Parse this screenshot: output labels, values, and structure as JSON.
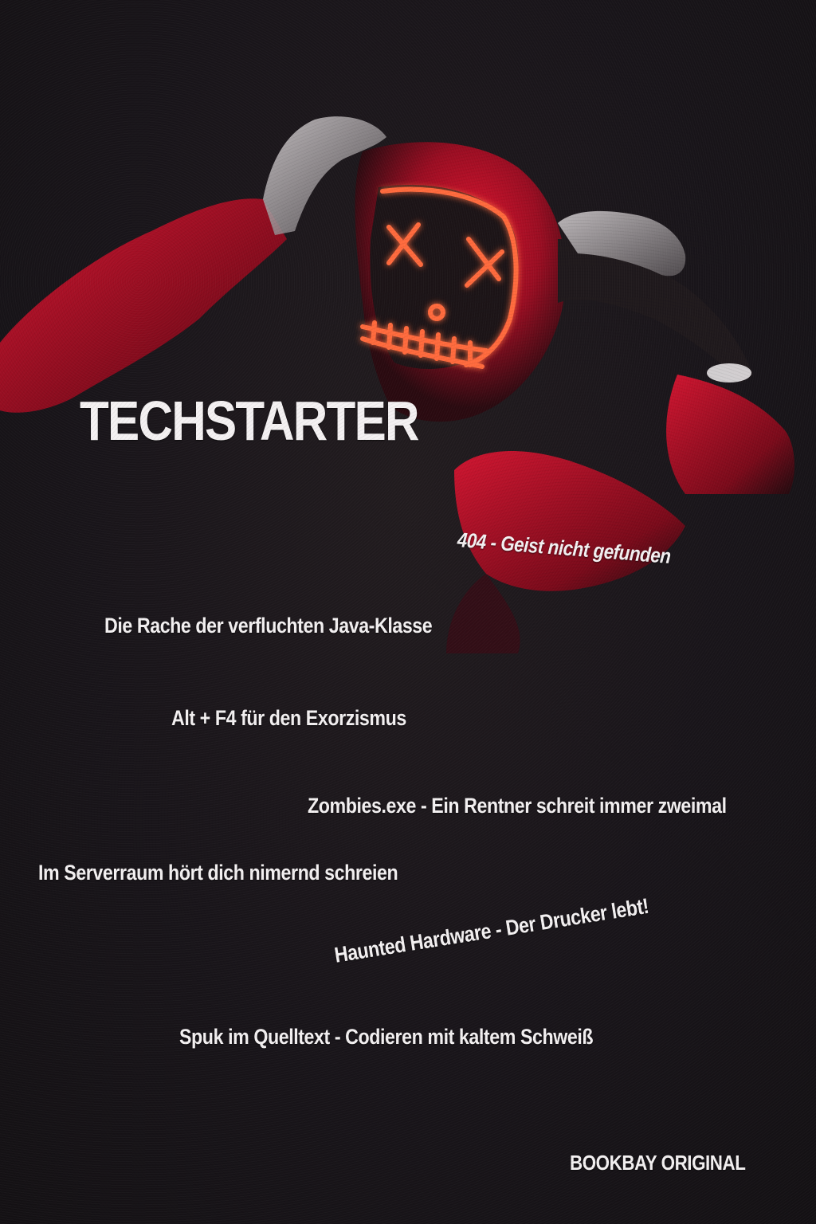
{
  "poster": {
    "title": "TECHSTARTER",
    "lines": [
      "404 - Geist nicht gefunden",
      "Die Rache der verfluchten Java-Klasse",
      "Alt + F4 für den Exorzismus",
      "Zombies.exe - Ein Rentner schreit immer zweimal",
      "Im Serverraum hört dich nimernd schreien",
      "Haunted Hardware - Der Drucker lebt!",
      "Spuk im Quelltext - Codieren mit kaltem Schweiß"
    ],
    "footer": "BOOKBAY ORIGINAL"
  },
  "colors": {
    "background": "#1a1618",
    "hoodie": "#c8102e",
    "mask_glow": "#ff6a3d",
    "text": "#f4f1f2"
  }
}
